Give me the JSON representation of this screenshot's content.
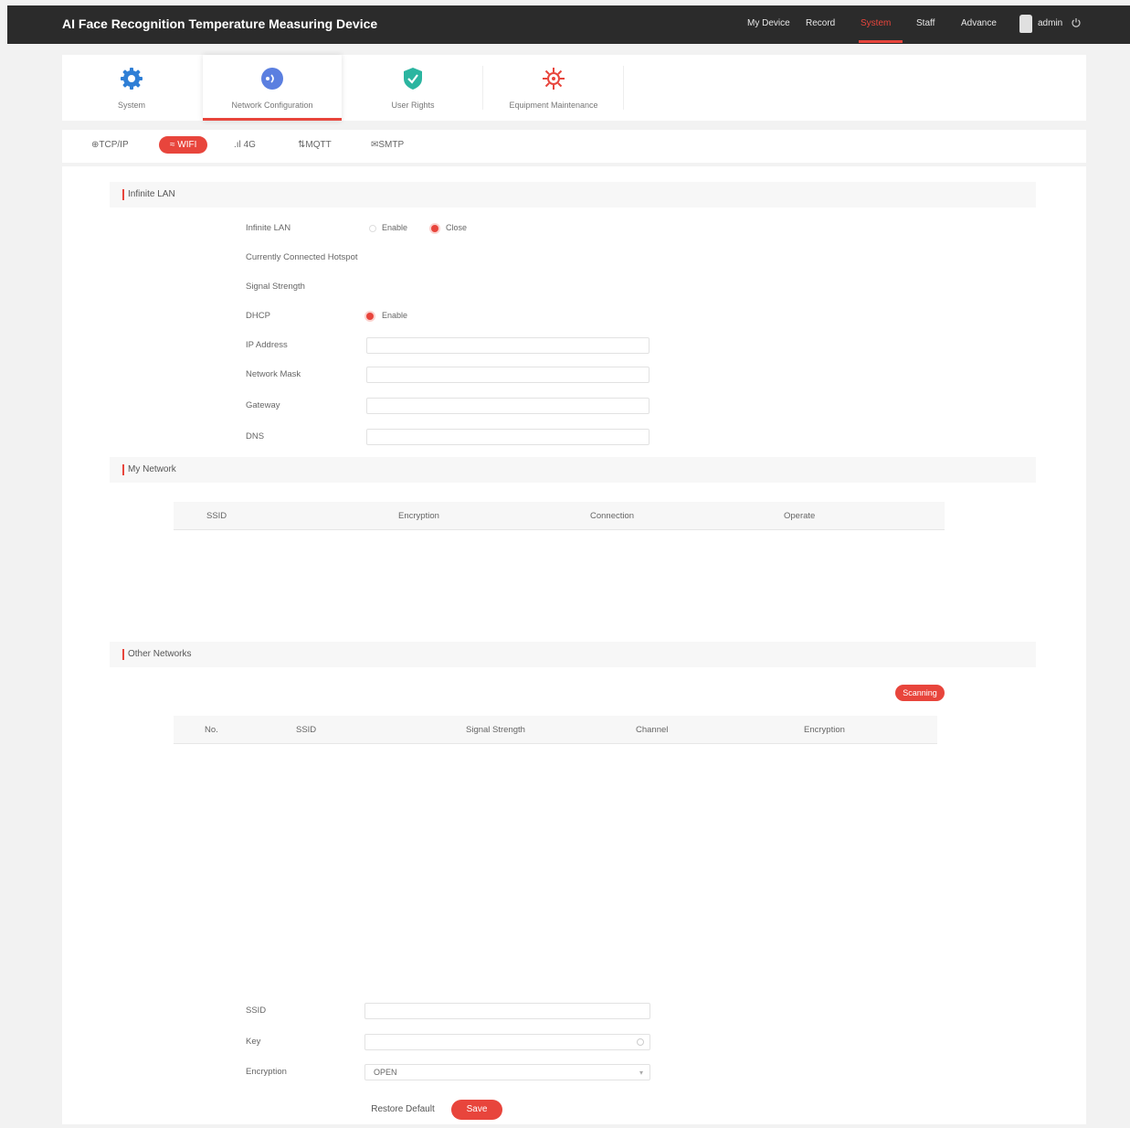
{
  "header": {
    "title": "AI Face Recognition Temperature Measuring Device",
    "nav": [
      "My Device",
      "Record",
      "System",
      "Staff",
      "Advance"
    ],
    "active_nav": "System",
    "user": "admin"
  },
  "modules": [
    {
      "label": "System",
      "icon": "gear-icon"
    },
    {
      "label": "Network Configuration",
      "icon": "network-icon"
    },
    {
      "label": "User Rights",
      "icon": "shield-check-icon"
    },
    {
      "label": "Equipment Maintenance",
      "icon": "maintenance-icon"
    }
  ],
  "active_module": "Network Configuration",
  "subtabs": [
    "TCP/IP",
    "WIFI",
    "4G",
    "MQTT",
    "SMTP"
  ],
  "active_subtab": "WIFI",
  "wlan": {
    "section_title": "Infinite LAN",
    "wlan_label": "Infinite LAN",
    "enable_label": "Enable",
    "close_label": "Close",
    "selected": "Close",
    "hotspot_label": "Currently Connected Hotspot",
    "signal_label": "Signal Strength",
    "dhcp_label": "DHCP",
    "dhcp_enable_label": "Enable",
    "ip_label": "IP Address",
    "mask_label": "Network Mask",
    "gateway_label": "Gateway",
    "dns_label": "DNS"
  },
  "my_network": {
    "section_title": "My Network",
    "columns": [
      "SSID",
      "Encryption",
      "Connection",
      "Operate"
    ]
  },
  "other_networks": {
    "section_title": "Other Networks",
    "scan_label": "Scanning",
    "columns": [
      "No.",
      "SSID",
      "Signal Strength",
      "Channel",
      "Encryption"
    ]
  },
  "connect_form": {
    "ssid_label": "SSID",
    "key_label": "Key",
    "encryption_label": "Encryption",
    "encryption_value": "OPEN"
  },
  "buttons": {
    "restore": "Restore Default",
    "save": "Save"
  },
  "colors": {
    "accent": "#e8453c",
    "topbar": "#2b2b2b"
  }
}
